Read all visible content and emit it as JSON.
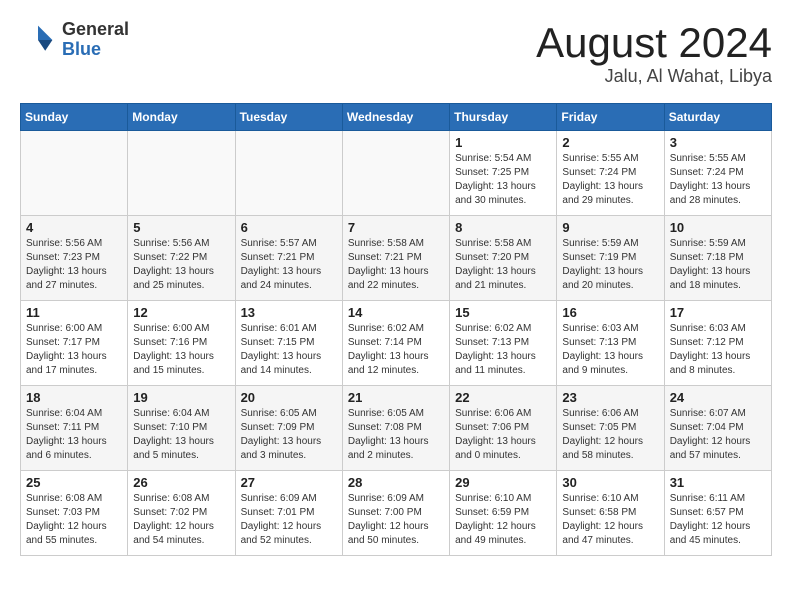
{
  "header": {
    "logo_general": "General",
    "logo_blue": "Blue",
    "month": "August 2024",
    "location": "Jalu, Al Wahat, Libya"
  },
  "days_of_week": [
    "Sunday",
    "Monday",
    "Tuesday",
    "Wednesday",
    "Thursday",
    "Friday",
    "Saturday"
  ],
  "weeks": [
    [
      {
        "day": "",
        "content": ""
      },
      {
        "day": "",
        "content": ""
      },
      {
        "day": "",
        "content": ""
      },
      {
        "day": "",
        "content": ""
      },
      {
        "day": "1",
        "content": "Sunrise: 5:54 AM\nSunset: 7:25 PM\nDaylight: 13 hours\nand 30 minutes."
      },
      {
        "day": "2",
        "content": "Sunrise: 5:55 AM\nSunset: 7:24 PM\nDaylight: 13 hours\nand 29 minutes."
      },
      {
        "day": "3",
        "content": "Sunrise: 5:55 AM\nSunset: 7:24 PM\nDaylight: 13 hours\nand 28 minutes."
      }
    ],
    [
      {
        "day": "4",
        "content": "Sunrise: 5:56 AM\nSunset: 7:23 PM\nDaylight: 13 hours\nand 27 minutes."
      },
      {
        "day": "5",
        "content": "Sunrise: 5:56 AM\nSunset: 7:22 PM\nDaylight: 13 hours\nand 25 minutes."
      },
      {
        "day": "6",
        "content": "Sunrise: 5:57 AM\nSunset: 7:21 PM\nDaylight: 13 hours\nand 24 minutes."
      },
      {
        "day": "7",
        "content": "Sunrise: 5:58 AM\nSunset: 7:21 PM\nDaylight: 13 hours\nand 22 minutes."
      },
      {
        "day": "8",
        "content": "Sunrise: 5:58 AM\nSunset: 7:20 PM\nDaylight: 13 hours\nand 21 minutes."
      },
      {
        "day": "9",
        "content": "Sunrise: 5:59 AM\nSunset: 7:19 PM\nDaylight: 13 hours\nand 20 minutes."
      },
      {
        "day": "10",
        "content": "Sunrise: 5:59 AM\nSunset: 7:18 PM\nDaylight: 13 hours\nand 18 minutes."
      }
    ],
    [
      {
        "day": "11",
        "content": "Sunrise: 6:00 AM\nSunset: 7:17 PM\nDaylight: 13 hours\nand 17 minutes."
      },
      {
        "day": "12",
        "content": "Sunrise: 6:00 AM\nSunset: 7:16 PM\nDaylight: 13 hours\nand 15 minutes."
      },
      {
        "day": "13",
        "content": "Sunrise: 6:01 AM\nSunset: 7:15 PM\nDaylight: 13 hours\nand 14 minutes."
      },
      {
        "day": "14",
        "content": "Sunrise: 6:02 AM\nSunset: 7:14 PM\nDaylight: 13 hours\nand 12 minutes."
      },
      {
        "day": "15",
        "content": "Sunrise: 6:02 AM\nSunset: 7:13 PM\nDaylight: 13 hours\nand 11 minutes."
      },
      {
        "day": "16",
        "content": "Sunrise: 6:03 AM\nSunset: 7:13 PM\nDaylight: 13 hours\nand 9 minutes."
      },
      {
        "day": "17",
        "content": "Sunrise: 6:03 AM\nSunset: 7:12 PM\nDaylight: 13 hours\nand 8 minutes."
      }
    ],
    [
      {
        "day": "18",
        "content": "Sunrise: 6:04 AM\nSunset: 7:11 PM\nDaylight: 13 hours\nand 6 minutes."
      },
      {
        "day": "19",
        "content": "Sunrise: 6:04 AM\nSunset: 7:10 PM\nDaylight: 13 hours\nand 5 minutes."
      },
      {
        "day": "20",
        "content": "Sunrise: 6:05 AM\nSunset: 7:09 PM\nDaylight: 13 hours\nand 3 minutes."
      },
      {
        "day": "21",
        "content": "Sunrise: 6:05 AM\nSunset: 7:08 PM\nDaylight: 13 hours\nand 2 minutes."
      },
      {
        "day": "22",
        "content": "Sunrise: 6:06 AM\nSunset: 7:06 PM\nDaylight: 13 hours\nand 0 minutes."
      },
      {
        "day": "23",
        "content": "Sunrise: 6:06 AM\nSunset: 7:05 PM\nDaylight: 12 hours\nand 58 minutes."
      },
      {
        "day": "24",
        "content": "Sunrise: 6:07 AM\nSunset: 7:04 PM\nDaylight: 12 hours\nand 57 minutes."
      }
    ],
    [
      {
        "day": "25",
        "content": "Sunrise: 6:08 AM\nSunset: 7:03 PM\nDaylight: 12 hours\nand 55 minutes."
      },
      {
        "day": "26",
        "content": "Sunrise: 6:08 AM\nSunset: 7:02 PM\nDaylight: 12 hours\nand 54 minutes."
      },
      {
        "day": "27",
        "content": "Sunrise: 6:09 AM\nSunset: 7:01 PM\nDaylight: 12 hours\nand 52 minutes."
      },
      {
        "day": "28",
        "content": "Sunrise: 6:09 AM\nSunset: 7:00 PM\nDaylight: 12 hours\nand 50 minutes."
      },
      {
        "day": "29",
        "content": "Sunrise: 6:10 AM\nSunset: 6:59 PM\nDaylight: 12 hours\nand 49 minutes."
      },
      {
        "day": "30",
        "content": "Sunrise: 6:10 AM\nSunset: 6:58 PM\nDaylight: 12 hours\nand 47 minutes."
      },
      {
        "day": "31",
        "content": "Sunrise: 6:11 AM\nSunset: 6:57 PM\nDaylight: 12 hours\nand 45 minutes."
      }
    ]
  ]
}
